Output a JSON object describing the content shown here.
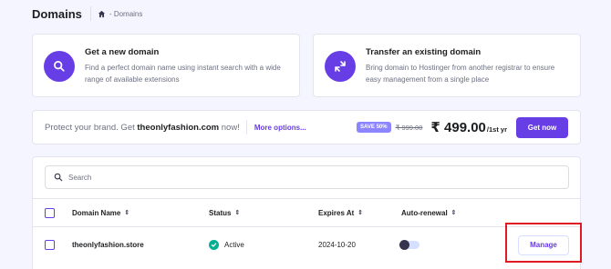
{
  "header": {
    "title": "Domains",
    "breadcrumb_separator": "-",
    "breadcrumb_current": "Domains"
  },
  "promos": [
    {
      "icon": "search-icon",
      "title": "Get a new domain",
      "description": "Find a perfect domain name using instant search with a wide range of available extensions"
    },
    {
      "icon": "transfer-arrows-icon",
      "title": "Transfer an existing domain",
      "description": "Bring domain to Hostinger from another registrar to ensure easy management from a single place"
    }
  ],
  "banner": {
    "prefix": "Protect your brand. Get",
    "domain": "theonlyfashion.com",
    "suffix": "now!",
    "more_link": "More options...",
    "save_badge": "SAVE 50%",
    "old_price": "₹ 999.00",
    "new_price": "₹ 499.00",
    "period": "/1st yr",
    "cta": "Get now"
  },
  "search": {
    "placeholder": "Search"
  },
  "table": {
    "columns": [
      "Domain Name",
      "Status",
      "Expires At",
      "Auto-renewal"
    ],
    "sort_glyph": "⇕",
    "rows": [
      {
        "domain": "theonlyfashion.store",
        "status": "Active",
        "expires": "2024-10-20",
        "auto_renewal": false,
        "action": "Manage"
      }
    ]
  },
  "colors": {
    "accent": "#673de6",
    "success": "#00b090",
    "badge": "#8c85ff",
    "highlight": "#e01b24"
  }
}
